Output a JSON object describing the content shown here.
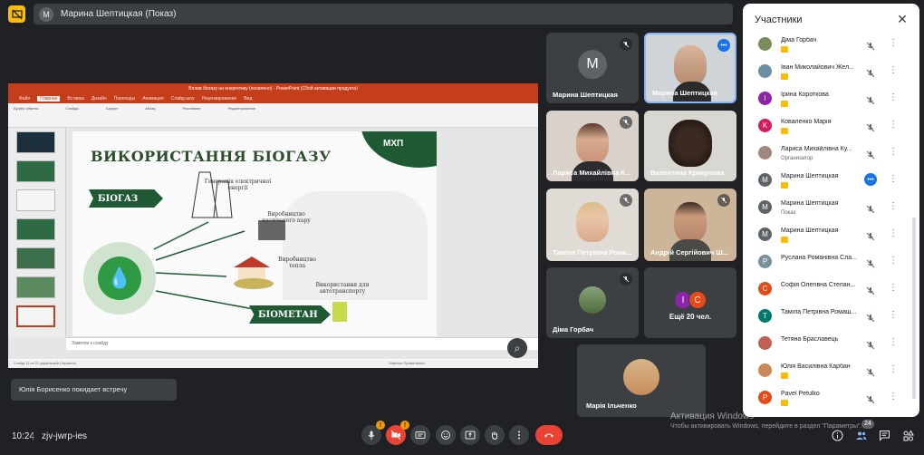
{
  "meeting": {
    "presenter_avatar_letter": "M",
    "presenter_label": "Марина Шептицкая (Показ)",
    "time": "10:24",
    "code": "zjv-jwrp-ies"
  },
  "presentation": {
    "window_title": "Вплив біогазу на енергетику (оновлено) - PowerPoint (Сбой активации продукта)",
    "tabs": [
      "Файл",
      "Главная",
      "Вставка",
      "Дизайн",
      "Переходы",
      "Анимация",
      "Слайд-шоу",
      "Рецензирование",
      "Вид"
    ],
    "active_tab": "Главная",
    "ribbon_groups": [
      "Буфер обмена",
      "Слайды",
      "Шрифт",
      "Абзац",
      "Рисование",
      "Редактирование"
    ],
    "slide": {
      "title": "ВИКОРИСТАННЯ БІОГАЗУ",
      "logo": "МХП",
      "tag_biogas": "БІОГАЗ",
      "tag_biomethane": "БІОМЕТАН",
      "label_electric": "Генерація електричної енергії",
      "label_steam": "Виробництво насиченого пару",
      "label_heat": "Виробництво тепла",
      "label_transport": "Використання для автотранспорту"
    },
    "notes_placeholder": "Заметки к слайду",
    "status_left": "Слайд 11 из 21   украинский (Украина)",
    "status_right": "Заметки   Примечания"
  },
  "tiles": [
    {
      "name": "Марина Шептицкая",
      "letter": "M",
      "type": "avatar",
      "muted": true
    },
    {
      "name": "Марина Шептицкая",
      "type": "camera",
      "active": true
    },
    {
      "name": "Лариса Михайлівна К...",
      "type": "camera",
      "muted": true
    },
    {
      "name": "Валентина Крикунова",
      "type": "camera"
    },
    {
      "name": "Таміла Петрівна Рома...",
      "type": "camera",
      "muted": true
    },
    {
      "name": "Андрій Сергійович Ш...",
      "type": "camera",
      "muted": true
    },
    {
      "name": "Діма Горбач",
      "type": "photo",
      "muted": true
    },
    {
      "name": "Ещё 20 чел.",
      "letters": [
        "I",
        "C"
      ],
      "type": "more"
    },
    {
      "name": "Марія Ільченко",
      "type": "photo"
    }
  ],
  "toast": "Юлія Борисенко покидает встречу",
  "panel": {
    "title": "Участники",
    "participants": [
      {
        "name": "Діма Горбач",
        "color": "#7b8c5a",
        "letter": "",
        "badge": true,
        "sub": ""
      },
      {
        "name": "Іван Миколайович Жел...",
        "color": "#6d8fa3",
        "letter": "",
        "badge": true,
        "sub": ""
      },
      {
        "name": "Ірина Короткова",
        "color": "#8e24aa",
        "letter": "I",
        "badge": true,
        "sub": ""
      },
      {
        "name": "Коваленко Марія",
        "color": "#d81b60",
        "letter": "K",
        "badge": true,
        "sub": ""
      },
      {
        "name": "Лариса Михайлівна Ку...",
        "color": "#a1887f",
        "letter": "",
        "badge": false,
        "sub": "Организатор"
      },
      {
        "name": "Марина Шептицкая",
        "color": "#5f6368",
        "letter": "M",
        "badge": true,
        "sub": "",
        "speaking": true
      },
      {
        "name": "Марина Шептицкая",
        "color": "#5f6368",
        "letter": "M",
        "badge": false,
        "sub": "Показ"
      },
      {
        "name": "Марина Шептицкая",
        "color": "#5f6368",
        "letter": "M",
        "badge": true,
        "sub": ""
      },
      {
        "name": "Руслана Романівна Сла...",
        "color": "#78909c",
        "letter": "P",
        "badge": false,
        "sub": ""
      },
      {
        "name": "Софія Олегівна Степан...",
        "color": "#e64a19",
        "letter": "C",
        "badge": false,
        "sub": ""
      },
      {
        "name": "Таміла Петрівна Ромаш...",
        "color": "#00796b",
        "letter": "T",
        "badge": false,
        "sub": ""
      },
      {
        "name": "Тетяна Браславець",
        "color": "#c06050",
        "letter": "",
        "badge": false,
        "sub": ""
      },
      {
        "name": "Юлія Василівна Карбан",
        "color": "#c98a5a",
        "letter": "",
        "badge": true,
        "sub": ""
      },
      {
        "name": "Pavel Petulko",
        "color": "#e64a19",
        "letter": "P",
        "badge": true,
        "sub": ""
      }
    ]
  },
  "watermark": {
    "line1": "Активация Windows",
    "line2": "Чтобы активировать Windows, перейдите в раздел \"Параметры\"."
  },
  "people_count": "24",
  "colors": {
    "accent": "#1a73e8",
    "danger": "#ea4335",
    "warning": "#f29900",
    "slide_green": "#1f5a35"
  }
}
